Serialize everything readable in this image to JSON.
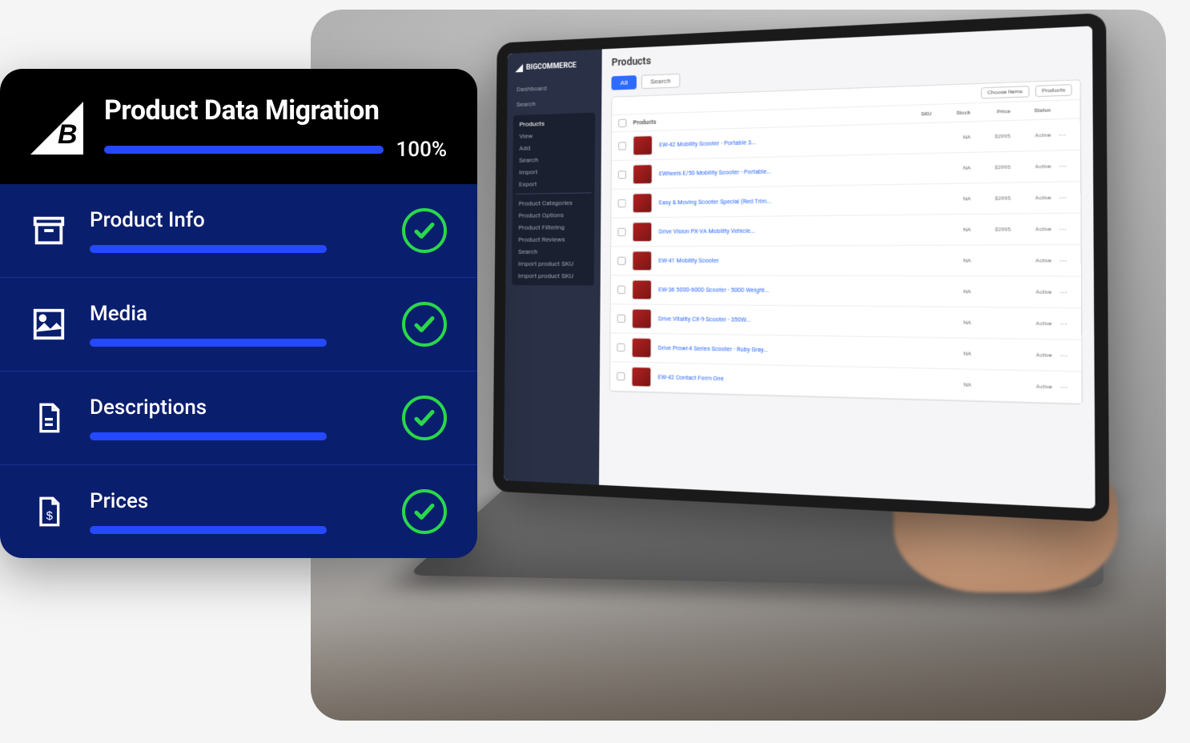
{
  "migration": {
    "title": "Product Data Migration",
    "percent": "100%",
    "items": [
      {
        "label": "Product Info",
        "icon": "archive-icon",
        "complete": true
      },
      {
        "label": "Media",
        "icon": "image-icon",
        "complete": true
      },
      {
        "label": "Descriptions",
        "icon": "file-text-icon",
        "complete": true
      },
      {
        "label": "Prices",
        "icon": "file-dollar-icon",
        "complete": true
      }
    ]
  },
  "laptop_screen": {
    "brand": "BIGCOMMERCE",
    "sidebar": {
      "top": [
        "Dashboard",
        "Search"
      ],
      "section": "Products",
      "items": [
        "View",
        "Add",
        "Search",
        "Import",
        "Export"
      ],
      "more": [
        "Product Categories",
        "Product Options",
        "Product Filtering",
        "Product Reviews",
        "Search",
        "Import product SKU",
        "Import product SKU"
      ]
    },
    "page_title": "Products",
    "tabs": {
      "active": "All",
      "other": "Search"
    },
    "toolbar": {
      "btn1": "Choose Items",
      "btn2": "Products"
    },
    "columns": [
      "Products",
      "SKU",
      "Stock",
      "Price",
      "Status"
    ],
    "rows": [
      {
        "name": "EW-42 Mobility Scooter - Portable 3...",
        "sku": "",
        "stock": "NA",
        "price": "$2995",
        "status": "Active"
      },
      {
        "name": "EWheels E/50 Mobility Scooter - Portable 3...",
        "sku": "",
        "stock": "NA",
        "price": "",
        "status": "Active"
      },
      "...",
      {
        "name": "EW-42 Contact Form One",
        "sku": "",
        "stock": "NA",
        "price": "",
        "status": "Active"
      }
    ],
    "rows_display": [
      "EW-42 Mobility Scooter - Portable 3...",
      "EWheels E/50 Mobility Scooter - Portable...",
      "Easy & Moving Scooter Special (Red Trim...",
      "Drive Vision PX-VA Mobility Vehicle...",
      "EW-41 Mobility Scooter",
      "EW-36 5000-6000 Scooter - 5000 Weight...",
      "Drive Vitality CX-9 Scooter - 350W...",
      "Drive Prowl-4 Series Scooter - Ruby Gray...",
      "EW-42 Contact Form One"
    ],
    "col_vals": {
      "stock": "NA",
      "price": "$2995",
      "status": "Active"
    }
  },
  "colors": {
    "accent": "#2449ff",
    "card_bg": "#0a1e6e",
    "success": "#29d84a"
  }
}
